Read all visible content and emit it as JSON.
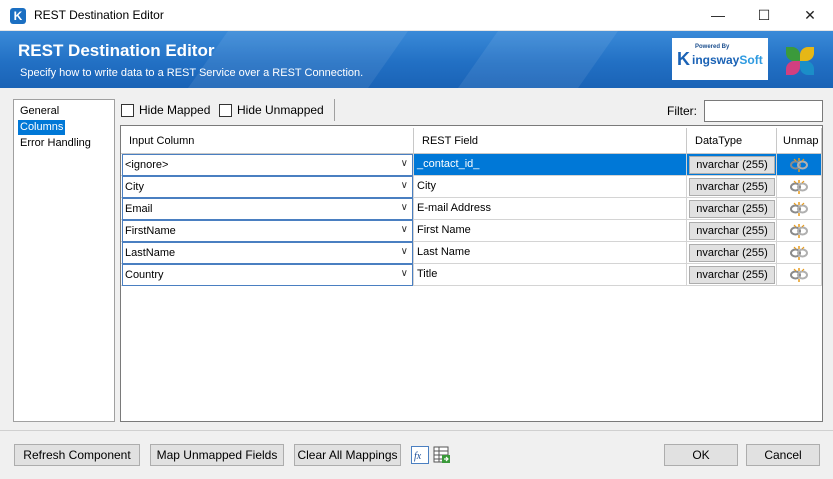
{
  "window": {
    "title": "REST Destination Editor",
    "app_icon": "K",
    "controls": {
      "minimize": "—",
      "maximize": "☐",
      "close": "✕"
    }
  },
  "banner": {
    "title": "REST Destination Editor",
    "subtitle": "Specify how to write data to a REST Service over a REST Connection.",
    "logo": {
      "powered": "Powered By",
      "brand_a": "ingsway",
      "brand_b": "Soft",
      "brand_k": "K"
    }
  },
  "nav": {
    "items": [
      {
        "label": "General",
        "selected": false
      },
      {
        "label": "Columns",
        "selected": true
      },
      {
        "label": "Error Handling",
        "selected": false
      }
    ]
  },
  "toolbar": {
    "hide_mapped": "Hide Mapped",
    "hide_unmapped": "Hide Unmapped",
    "filter_label": "Filter:",
    "filter_value": ""
  },
  "grid": {
    "headers": [
      "Input Column",
      "REST Field",
      "DataType",
      "Unmap"
    ],
    "rows": [
      {
        "input": "<ignore>",
        "field": "_contact_id_",
        "datatype": "nvarchar (255)",
        "selected": true
      },
      {
        "input": "City",
        "field": "City",
        "datatype": "nvarchar (255)",
        "selected": false
      },
      {
        "input": "Email",
        "field": "E-mail Address",
        "datatype": "nvarchar (255)",
        "selected": false
      },
      {
        "input": "FirstName",
        "field": "First Name",
        "datatype": "nvarchar (255)",
        "selected": false
      },
      {
        "input": "LastName",
        "field": "Last Name",
        "datatype": "nvarchar (255)",
        "selected": false
      },
      {
        "input": "Country",
        "field": "Title",
        "datatype": "nvarchar (255)",
        "selected": false
      }
    ]
  },
  "footer": {
    "refresh": "Refresh Component",
    "map_unmapped": "Map Unmapped Fields",
    "clear_all": "Clear All Mappings",
    "ok": "OK",
    "cancel": "Cancel",
    "icons": [
      "fx-expression-icon",
      "export-grid-icon"
    ]
  },
  "colors": {
    "accent": "#0078d7",
    "banner": "#2270c4"
  }
}
